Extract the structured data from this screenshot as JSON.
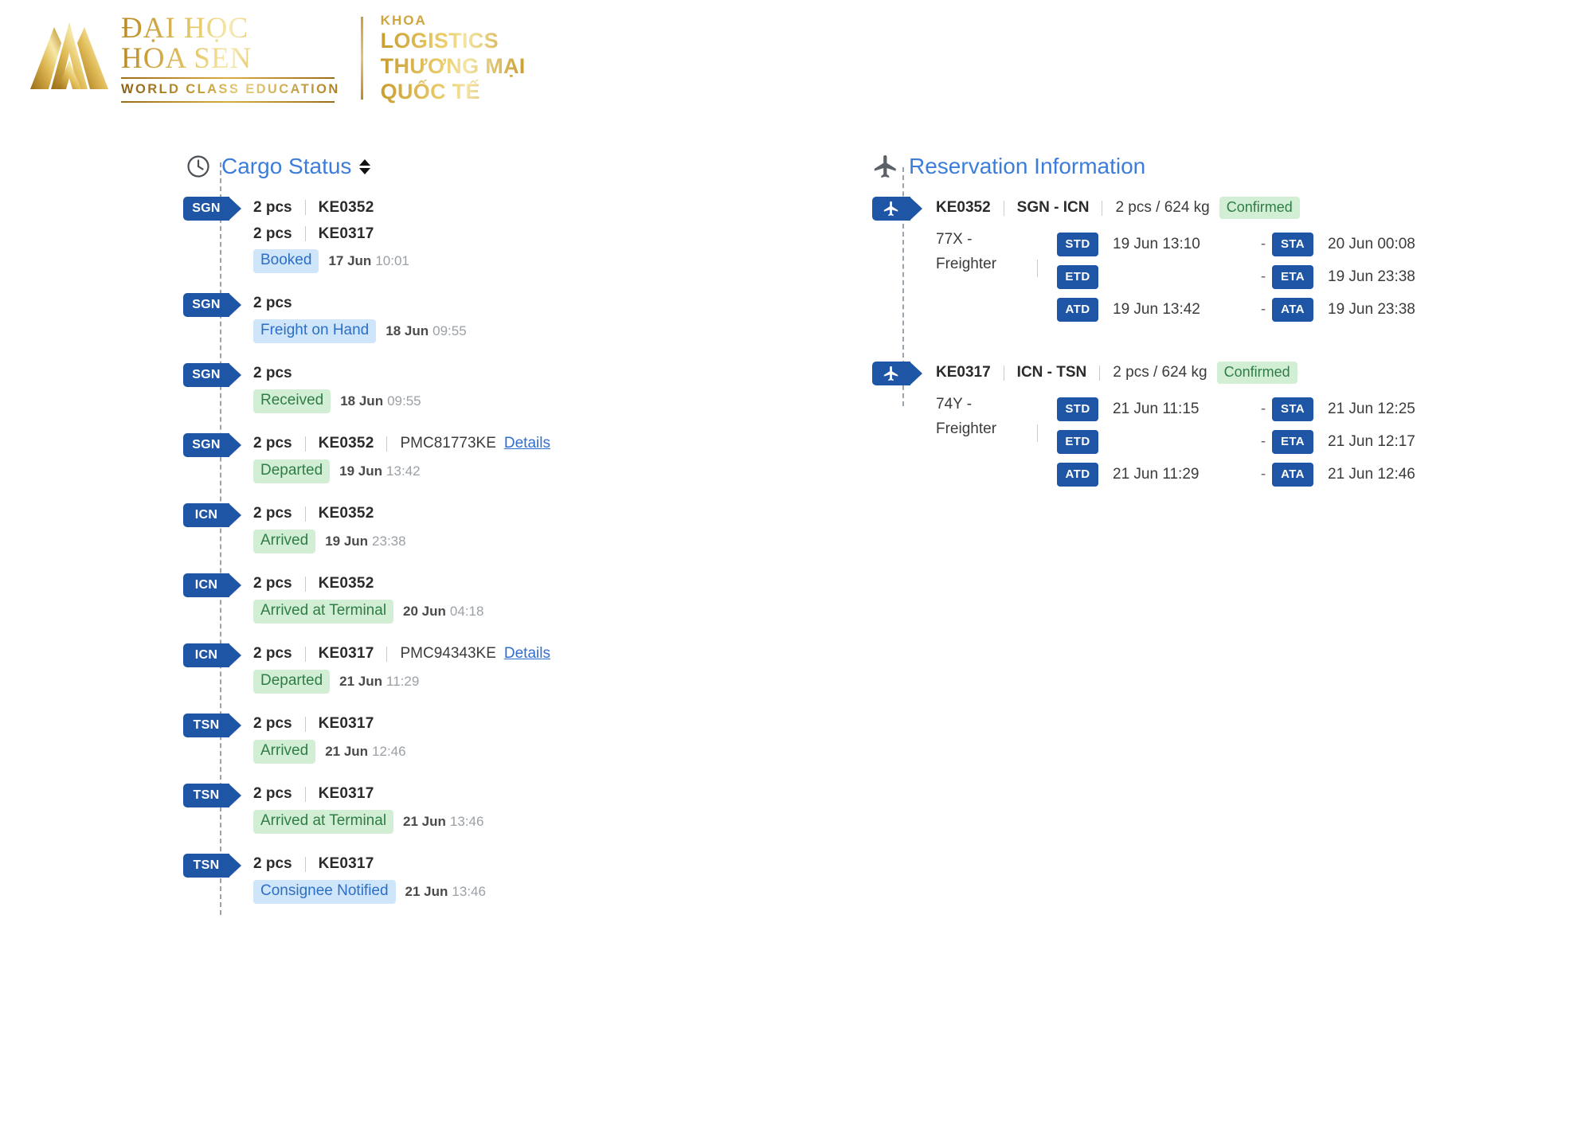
{
  "logo": {
    "university_line1": "ĐẠI HỌC",
    "university_line2": "HOA SEN",
    "tagline": "WORLD CLASS EDUCATION",
    "dept_prefix": "KHOA",
    "dept_line1": "LOGISTICS",
    "dept_line2": "THƯƠNG MẠI",
    "dept_line3": "QUỐC TẾ",
    "gold": "#c79b2e"
  },
  "cargo": {
    "icon": "clock-icon",
    "title": "Cargo Status",
    "sort_icon": "sort-updown-icon",
    "events": [
      {
        "station": "SGN",
        "lines": [
          {
            "pcs": "2 pcs",
            "flight": "KE0352"
          },
          {
            "pcs": "2 pcs",
            "flight": "KE0317"
          }
        ],
        "status": "Booked",
        "status_tone": "blue",
        "date": "17 Jun",
        "time": "10:01"
      },
      {
        "station": "SGN",
        "lines": [
          {
            "pcs": "2 pcs",
            "flight": ""
          }
        ],
        "status": "Freight on Hand",
        "status_tone": "blue",
        "date": "18 Jun",
        "time": "09:55"
      },
      {
        "station": "SGN",
        "lines": [
          {
            "pcs": "2 pcs",
            "flight": ""
          }
        ],
        "status": "Received",
        "status_tone": "green",
        "date": "18 Jun",
        "time": "09:55"
      },
      {
        "station": "SGN",
        "lines": [
          {
            "pcs": "2 pcs",
            "flight": "KE0352",
            "uld": "PMC81773KE",
            "details": "Details"
          }
        ],
        "status": "Departed",
        "status_tone": "green",
        "date": "19 Jun",
        "time": "13:42"
      },
      {
        "station": "ICN",
        "lines": [
          {
            "pcs": "2 pcs",
            "flight": "KE0352"
          }
        ],
        "status": "Arrived",
        "status_tone": "green",
        "date": "19 Jun",
        "time": "23:38"
      },
      {
        "station": "ICN",
        "lines": [
          {
            "pcs": "2 pcs",
            "flight": "KE0352"
          }
        ],
        "status": "Arrived at Terminal",
        "status_tone": "green",
        "date": "20 Jun",
        "time": "04:18"
      },
      {
        "station": "ICN",
        "lines": [
          {
            "pcs": "2 pcs",
            "flight": "KE0317",
            "uld": "PMC94343KE",
            "details": "Details"
          }
        ],
        "status": "Departed",
        "status_tone": "green",
        "date": "21 Jun",
        "time": "11:29"
      },
      {
        "station": "TSN",
        "lines": [
          {
            "pcs": "2 pcs",
            "flight": "KE0317"
          }
        ],
        "status": "Arrived",
        "status_tone": "green",
        "date": "21 Jun",
        "time": "12:46"
      },
      {
        "station": "TSN",
        "lines": [
          {
            "pcs": "2 pcs",
            "flight": "KE0317"
          }
        ],
        "status": "Arrived at Terminal",
        "status_tone": "green",
        "date": "21 Jun",
        "time": "13:46"
      },
      {
        "station": "TSN",
        "lines": [
          {
            "pcs": "2 pcs",
            "flight": "KE0317"
          }
        ],
        "status": "Consignee Notified",
        "status_tone": "blue",
        "date": "21 Jun",
        "time": "13:46"
      }
    ]
  },
  "reservation": {
    "icon": "airplane-icon",
    "title": "Reservation Information",
    "segments": [
      {
        "badge_icon": "airplane-badge-icon",
        "flight": "KE0352",
        "route": "SGN - ICN",
        "load": "2 pcs / 624 kg",
        "status": "Confirmed",
        "aircraft_line1": "77X -",
        "aircraft_line2": "Freighter",
        "rows": [
          {
            "dep_label": "STD",
            "dep_value": "19 Jun 13:10",
            "dash": "-",
            "arr_label": "STA",
            "arr_value": "20 Jun 00:08"
          },
          {
            "dep_label": "ETD",
            "dep_value": "",
            "dash": "-",
            "arr_label": "ETA",
            "arr_value": "19 Jun 23:38"
          },
          {
            "dep_label": "ATD",
            "dep_value": "19 Jun 13:42",
            "dash": "-",
            "arr_label": "ATA",
            "arr_value": "19 Jun 23:38"
          }
        ]
      },
      {
        "badge_icon": "airplane-badge-icon",
        "flight": "KE0317",
        "route": "ICN - TSN",
        "load": "2 pcs / 624 kg",
        "status": "Confirmed",
        "aircraft_line1": "74Y -",
        "aircraft_line2": "Freighter",
        "rows": [
          {
            "dep_label": "STD",
            "dep_value": "21 Jun 11:15",
            "dash": "-",
            "arr_label": "STA",
            "arr_value": "21 Jun 12:25"
          },
          {
            "dep_label": "ETD",
            "dep_value": "",
            "dash": "-",
            "arr_label": "ETA",
            "arr_value": "21 Jun 12:17"
          },
          {
            "dep_label": "ATD",
            "dep_value": "21 Jun 11:29",
            "dash": "-",
            "arr_label": "ATA",
            "arr_value": "21 Jun 12:46"
          }
        ]
      }
    ]
  }
}
